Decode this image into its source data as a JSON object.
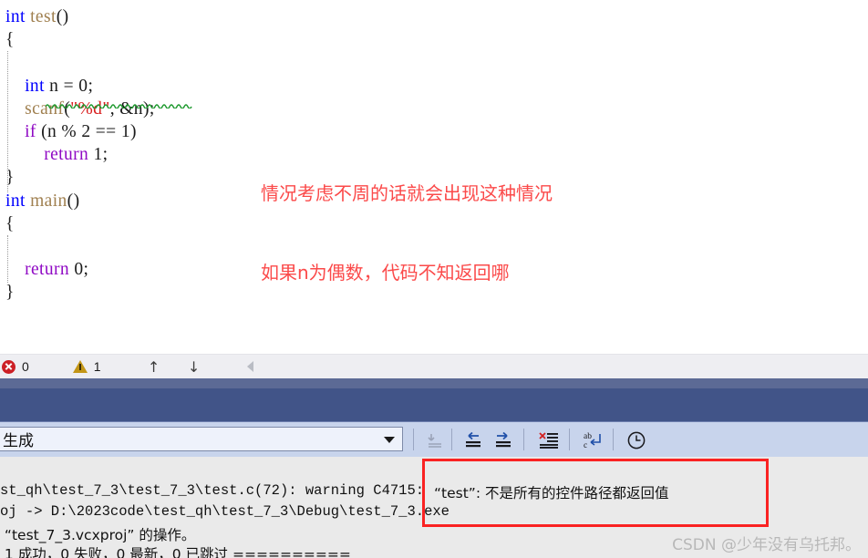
{
  "editor": {
    "language": "c",
    "lines": [
      {
        "indent": 0,
        "tokens": [
          {
            "t": "int",
            "c": "kw"
          },
          {
            "t": " ",
            "c": "plain"
          },
          {
            "t": "test",
            "c": "fn"
          },
          {
            "t": "()",
            "c": "plain"
          }
        ]
      },
      {
        "indent": 0,
        "tokens": [
          {
            "t": "{",
            "c": "brace"
          }
        ]
      },
      {
        "indent": 0,
        "tokens": [
          {
            "t": "",
            "c": "plain"
          }
        ]
      },
      {
        "indent": 4,
        "tokens": [
          {
            "t": "int",
            "c": "kw"
          },
          {
            "t": " n = ",
            "c": "plain"
          },
          {
            "t": "0",
            "c": "num"
          },
          {
            "t": ";",
            "c": "plain"
          }
        ]
      },
      {
        "indent": 4,
        "tokens": [
          {
            "t": "scanf",
            "c": "fn"
          },
          {
            "t": "(",
            "c": "plain"
          },
          {
            "t": "\"%d\"",
            "c": "str"
          },
          {
            "t": ", &n);",
            "c": "plain"
          }
        ]
      },
      {
        "indent": 4,
        "tokens": [
          {
            "t": "if",
            "c": "ctl"
          },
          {
            "t": " (n % ",
            "c": "plain"
          },
          {
            "t": "2",
            "c": "num"
          },
          {
            "t": " == ",
            "c": "plain"
          },
          {
            "t": "1",
            "c": "num"
          },
          {
            "t": ")",
            "c": "plain"
          }
        ]
      },
      {
        "indent": 8,
        "tokens": [
          {
            "t": "return",
            "c": "ctl"
          },
          {
            "t": " ",
            "c": "plain"
          },
          {
            "t": "1",
            "c": "num"
          },
          {
            "t": ";",
            "c": "plain"
          }
        ]
      },
      {
        "indent": 0,
        "tokens": [
          {
            "t": "}",
            "c": "brace"
          }
        ]
      },
      {
        "indent": 0,
        "tokens": [
          {
            "t": "int",
            "c": "kw"
          },
          {
            "t": " ",
            "c": "plain"
          },
          {
            "t": "main",
            "c": "fn"
          },
          {
            "t": "()",
            "c": "plain"
          }
        ]
      },
      {
        "indent": 0,
        "tokens": [
          {
            "t": "{",
            "c": "brace"
          }
        ]
      },
      {
        "indent": 0,
        "tokens": [
          {
            "t": "",
            "c": "plain"
          }
        ]
      },
      {
        "indent": 4,
        "tokens": [
          {
            "t": "return",
            "c": "ctl"
          },
          {
            "t": " ",
            "c": "plain"
          },
          {
            "t": "0",
            "c": "num"
          },
          {
            "t": ";",
            "c": "plain"
          }
        ]
      },
      {
        "indent": 0,
        "tokens": [
          {
            "t": "}",
            "c": "brace"
          }
        ]
      }
    ]
  },
  "annotation": {
    "color": "#fb4a4a",
    "line1": "情况考虑不周的话就会出现这种情况",
    "line2": "如果n为偶数，代码不知返回哪"
  },
  "error_strip": {
    "error_count": "0",
    "warning_count": "1",
    "prev_arrow": "↑",
    "next_arrow": "↓"
  },
  "output_toolbar": {
    "source_label": "生成",
    "buttons": [
      {
        "name": "goto-message-source",
        "title": "转到消息源"
      },
      {
        "name": "find-previous-message",
        "title": "查找上一条消息"
      },
      {
        "name": "find-next-message",
        "title": "查找下一条消息"
      },
      {
        "name": "clear-pane",
        "title": "全部清除"
      },
      {
        "name": "toggle-word-wrap",
        "title": "自动换行"
      },
      {
        "name": "show-timestamps",
        "title": "显示时间戳"
      }
    ]
  },
  "output_pane": {
    "lines": [
      "st_qh\\test_7_3\\test_7_3\\test.c(72): warning C4715: ",
      "oj -> D:\\2023code\\test_qh\\test_7_3\\Debug\\test_7_3.exe",
      " “test_7_3.vcxproj” 的操作。",
      " 1 成功，0 失败，0 最新，0 已跳过 =========="
    ],
    "highlighted_warning": "“test”: 不是所有的控件路径都返回值",
    "highlight_color": "#fa2222"
  },
  "watermark": "CSDN @少年没有乌托邦。",
  "colors": {
    "keyword": "#0000ff",
    "control": "#8f08c4",
    "function": "#a08050",
    "string": "#d92020",
    "band_light": "#5c6a95",
    "band_dark": "#415488",
    "toolbar_bg": "#c8d4ec",
    "output_bg": "#eaeaea",
    "error_red": "#cc1f25",
    "warning_gold": "#c39617"
  }
}
